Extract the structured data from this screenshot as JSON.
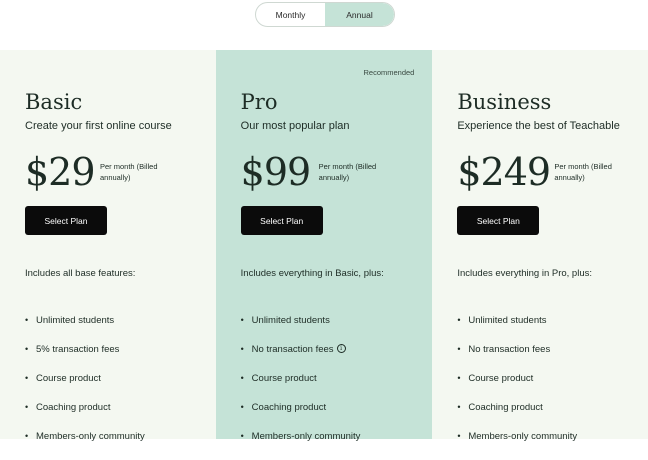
{
  "billing_toggle": {
    "monthly_label": "Monthly",
    "annual_label": "Annual",
    "selected": "Annual"
  },
  "colors": {
    "featured_bg": "#c5e3d7",
    "card_bg": "#f4f8f1",
    "button_bg": "#0b0b0b",
    "text": "#1d2c25"
  },
  "plans": [
    {
      "name": "Basic",
      "tagline": "Create your first online course",
      "price": "$29",
      "price_note": "Per month (Billed annually)",
      "button_label": "Select Plan",
      "includes": "Includes all base features:",
      "features": [
        "Unlimited students",
        "5% transaction fees",
        "Course product",
        "Coaching product",
        "Members-only community"
      ]
    },
    {
      "name": "Pro",
      "badge": "Recommended",
      "tagline": "Our most popular plan",
      "price": "$99",
      "price_note": "Per month (Billed annually)",
      "button_label": "Select Plan",
      "includes": "Includes everything in Basic, plus:",
      "features": [
        "Unlimited students",
        "No transaction fees",
        "Course product",
        "Coaching product",
        "Members-only community"
      ]
    },
    {
      "name": "Business",
      "tagline": "Experience the best of Teachable",
      "price": "$249",
      "price_note": "Per month (Billed annually)",
      "button_label": "Select Plan",
      "includes": "Includes everything in Pro, plus:",
      "features": [
        "Unlimited students",
        "No transaction fees",
        "Course product",
        "Coaching product",
        "Members-only community"
      ]
    }
  ],
  "info_icon_glyph": "i",
  "bullet_glyph": "•"
}
